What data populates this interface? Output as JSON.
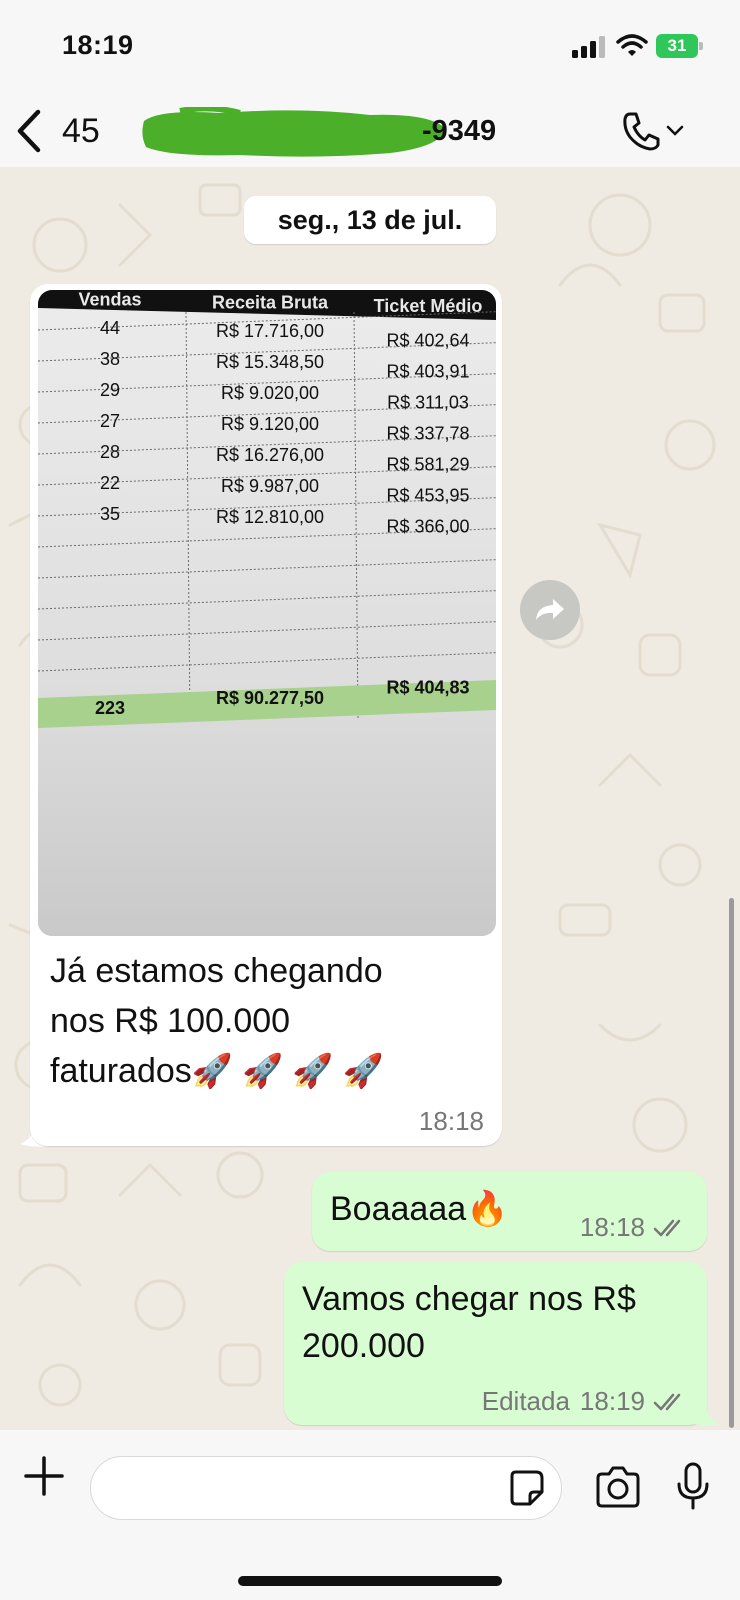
{
  "status_bar": {
    "time": "18:19",
    "battery": "31"
  },
  "header": {
    "back_count": "45",
    "contact_suffix": "-9349"
  },
  "chat": {
    "date_pill": "seg., 13 de jul.",
    "incoming": {
      "spreadsheet": {
        "headers": [
          "Vendas",
          "Receita Bruta",
          "Ticket Médio"
        ],
        "rows": [
          [
            "44",
            "R$ 17.716,00",
            "R$ 402,64"
          ],
          [
            "38",
            "R$ 15.348,50",
            "R$ 403,91"
          ],
          [
            "29",
            "R$ 9.020,00",
            "R$ 311,03"
          ],
          [
            "27",
            "R$ 9.120,00",
            "R$ 337,78"
          ],
          [
            "28",
            "R$ 16.276,00",
            "R$ 581,29"
          ],
          [
            "22",
            "R$ 9.987,00",
            "R$ 453,95"
          ],
          [
            "35",
            "R$ 12.810,00",
            "R$ 366,00"
          ]
        ],
        "total": [
          "223",
          "R$ 90.277,50",
          "R$ 404,83"
        ]
      },
      "caption_line1": "Já estamos chegando",
      "caption_line2": "nos R$ 100.000",
      "caption_line3": "faturados",
      "caption_emoji": "🚀 🚀 🚀 🚀",
      "time": "18:18"
    },
    "outgoing": [
      {
        "text": "Boaaaaa🔥",
        "time": "18:18",
        "status": "read"
      },
      {
        "text_line1": "Vamos chegar nos R$",
        "text_line2": "200.000",
        "edited_label": "Editada",
        "time": "18:19",
        "status": "read"
      }
    ]
  },
  "input_bar": {
    "placeholder": ""
  },
  "colors": {
    "chat_background": "#efeae2",
    "outgoing_bubble": "#d9fdd3",
    "incoming_bubble": "#ffffff",
    "read_ticks": "#777777",
    "battery": "#30c75a",
    "redaction": "#4caf2a"
  },
  "icons": [
    "signal-icon",
    "wifi-icon",
    "battery-icon",
    "chevron-left-icon",
    "phone-icon",
    "chevron-down-icon",
    "forward-icon",
    "plus-icon",
    "sticker-icon",
    "camera-icon",
    "microphone-icon",
    "double-check-icon"
  ]
}
